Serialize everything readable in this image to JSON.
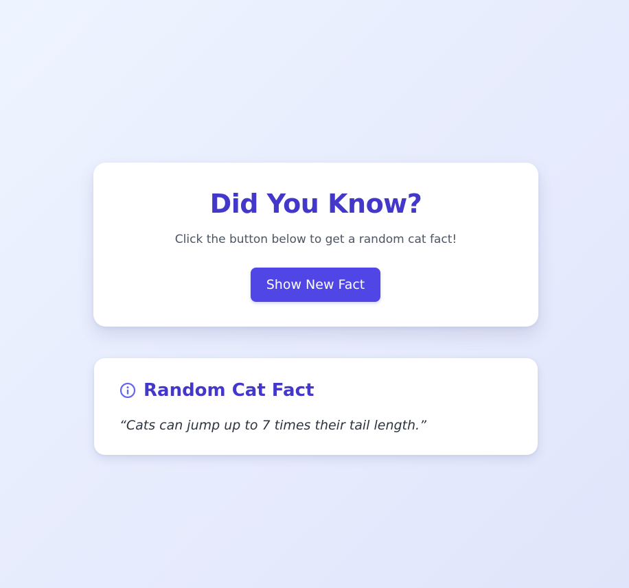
{
  "hero": {
    "title": "Did You Know?",
    "subtitle": "Click the button below to get a random cat fact!",
    "button_label": "Show New Fact"
  },
  "fact_card": {
    "icon": "info-icon",
    "title": "Random Cat Fact",
    "fact_text": "“Cats can jump up to 7 times their tail length.”"
  },
  "colors": {
    "accent": "#4338ca",
    "button": "#4f46e5",
    "icon": "#6366f1",
    "background": "#e7ecfd"
  }
}
